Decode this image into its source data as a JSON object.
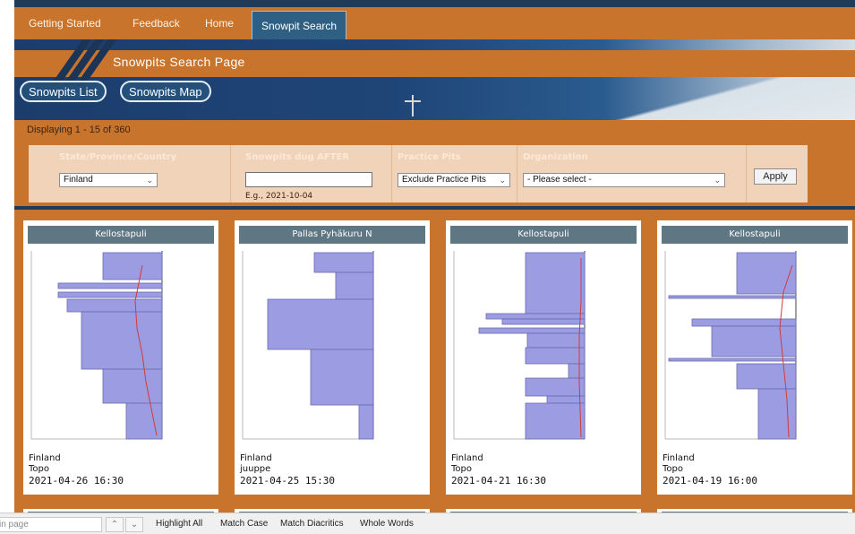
{
  "nav": {
    "items": [
      "Getting Started",
      "Feedback",
      "Home"
    ],
    "active": "Snowpit Search"
  },
  "banner": {
    "title": "Snowpits Search Page",
    "tabs": [
      "Snowpits List",
      "Snowpits Map"
    ]
  },
  "status": {
    "text": "Displaying 1 - 15 of 360"
  },
  "filters": {
    "country_label": "State/Province/Country",
    "country_value": "Finland",
    "dug_after_label": "Snowpits dug AFTER",
    "dug_after_value": "",
    "dug_after_hint": "E.g., 2021-10-04",
    "practice_label": "Practice Pits",
    "practice_value": "Exclude Practice Pits",
    "org_label": "Organization",
    "org_value": "- Please select -",
    "apply_label": "Apply"
  },
  "cards": [
    {
      "title": "Kellostapuli",
      "country": "Finland",
      "user": "Topo",
      "date": "2021-04-26 16:30"
    },
    {
      "title": "Pallas Pyhäkuru N",
      "country": "Finland",
      "user": "juuppe",
      "date": "2021-04-25 15:30"
    },
    {
      "title": "Kellostapuli",
      "country": "Finland",
      "user": "Topo",
      "date": "2021-04-21 16:30"
    },
    {
      "title": "Kellostapuli",
      "country": "Finland",
      "user": "Topo",
      "date": "2021-04-19 16:00"
    }
  ],
  "findbar": {
    "placeholder": "in page",
    "options": [
      "Highlight All",
      "Match Case",
      "Match Diacritics",
      "Whole Words"
    ]
  },
  "colors": {
    "orange": "#c8742c",
    "navy": "#1f3b58",
    "card_header": "#5f7683",
    "profile_fill": "#9c9ce3",
    "temp_line": "#d33a3a"
  }
}
